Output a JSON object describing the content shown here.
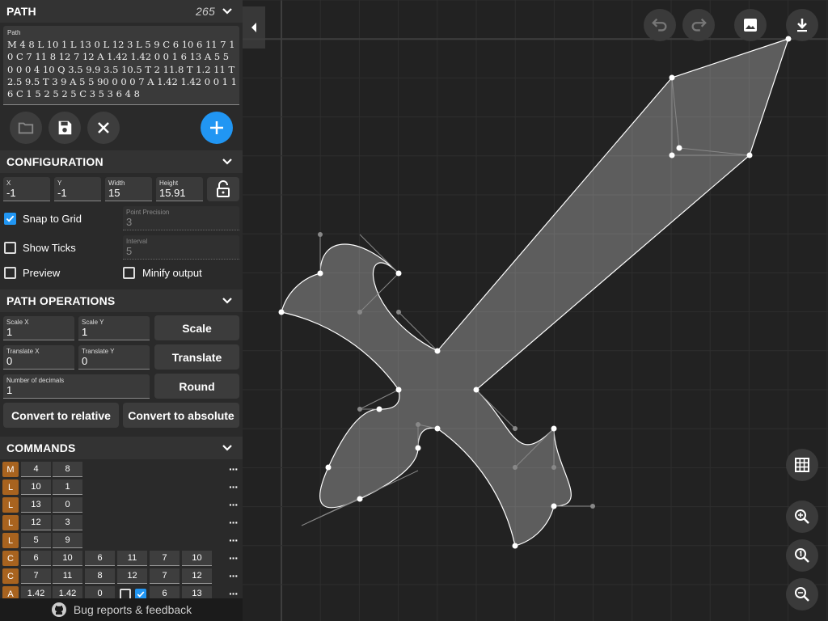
{
  "path_panel": {
    "title": "PATH",
    "count": "265",
    "path_label": "Path",
    "path_value": "M 4 8 L 10 1 L 13 0 L 12 3 L 5 9 C 6 10 6 11 7 10 C 7 11 8 12 7 12 A 1.42 1.42 0 0 1 6 13 A 5 5 0 0 0 4 10 Q 3.5 9.9 3.5 10.5 T 2 11.8 T 1.2 11 T 2.5 9.5 T 3 9 A 5 5 90 0 0 0 7 A 1.42 1.42 0 0 1 1 6 C 1 5 2 5 2 5 C 3 5 3 6 4 8"
  },
  "configuration": {
    "title": "CONFIGURATION",
    "x": {
      "label": "X",
      "value": "-1"
    },
    "y": {
      "label": "Y",
      "value": "-1"
    },
    "width": {
      "label": "Width",
      "value": "15"
    },
    "height": {
      "label": "Height",
      "value": "15.91"
    },
    "snap_to_grid": {
      "label": "Snap to Grid",
      "checked": true
    },
    "show_ticks": {
      "label": "Show Ticks",
      "checked": false
    },
    "preview": {
      "label": "Preview",
      "checked": false
    },
    "minify_output": {
      "label": "Minify output",
      "checked": false
    },
    "point_precision": {
      "label": "Point Precision",
      "value": "3"
    },
    "interval": {
      "label": "Interval",
      "value": "5"
    }
  },
  "path_operations": {
    "title": "PATH OPERATIONS",
    "scale_x": {
      "label": "Scale X",
      "value": "1"
    },
    "scale_y": {
      "label": "Scale Y",
      "value": "1"
    },
    "scale_button": "Scale",
    "translate_x": {
      "label": "Translate X",
      "value": "0"
    },
    "translate_y": {
      "label": "Translate Y",
      "value": "0"
    },
    "translate_button": "Translate",
    "decimals": {
      "label": "Number of decimals",
      "value": "1"
    },
    "round_button": "Round",
    "to_relative_button": "Convert to relative",
    "to_absolute_button": "Convert to absolute"
  },
  "commands": {
    "title": "COMMANDS",
    "rows": [
      {
        "cmd": "M",
        "values": [
          "4",
          "8"
        ]
      },
      {
        "cmd": "L",
        "values": [
          "10",
          "1"
        ]
      },
      {
        "cmd": "L",
        "values": [
          "13",
          "0"
        ]
      },
      {
        "cmd": "L",
        "values": [
          "12",
          "3"
        ]
      },
      {
        "cmd": "L",
        "values": [
          "5",
          "9"
        ]
      },
      {
        "cmd": "C",
        "values": [
          "6",
          "10",
          "6",
          "11",
          "7",
          "10"
        ]
      },
      {
        "cmd": "C",
        "values": [
          "7",
          "11",
          "8",
          "12",
          "7",
          "12"
        ]
      },
      {
        "cmd": "A",
        "values": [
          "1.42",
          "1.42",
          "0"
        ],
        "flags": [
          false,
          true
        ],
        "end": [
          "6",
          "13"
        ]
      }
    ],
    "more_icon": "more-horizontal-icon"
  },
  "footer": {
    "label": "Bug reports & feedback",
    "icon": "github-icon"
  },
  "toolbar": {
    "undo_icon": "undo-icon",
    "redo_icon": "redo-icon",
    "image_icon": "image-icon",
    "download_icon": "download-icon",
    "grid_icon": "grid-icon",
    "zoom_in_icon": "zoom-in-icon",
    "zoom_fit_icon": "zoom-fit-icon",
    "zoom_out_icon": "zoom-out-icon"
  },
  "colors": {
    "accent": "#2196f3",
    "command_letter": "#a8631f",
    "sidebar": "#2a2a2a",
    "canvas": "#222222"
  }
}
